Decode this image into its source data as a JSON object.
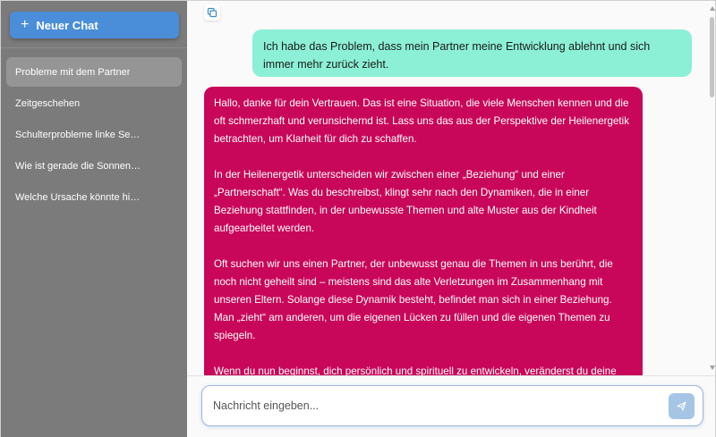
{
  "sidebar": {
    "new_chat_label": "Neuer Chat",
    "items": [
      {
        "label": "Probleme mit dem Partner",
        "active": true
      },
      {
        "label": "Zeitgeschehen"
      },
      {
        "label": "Schulterprobleme linke Se…"
      },
      {
        "label": "Wie ist gerade die Sonnen…"
      },
      {
        "label": "Welche Ursache könnte hi…"
      }
    ]
  },
  "chat": {
    "user_message": "Ich habe das Problem, dass mein Partner meine Entwicklung ablehnt und sich immer mehr zurück zieht.",
    "assistant_paragraphs": [
      "Hallo, danke für dein Vertrauen. Das ist eine Situation, die viele Menschen kennen und die oft schmerzhaft und verunsichernd ist. Lass uns das aus der Perspektive der Heilenergetik betrachten, um Klarheit für dich zu schaffen.",
      "In der Heilenergetik unterscheiden wir zwischen einer „Beziehung“ und einer „Partnerschaft“. Was du beschreibst, klingt sehr nach den Dynamiken, die in einer Beziehung stattfinden, in der unbewusste Themen und alte Muster aus der Kindheit aufgearbeitet werden.",
      "Oft suchen wir uns einen Partner, der unbewusst genau die Themen in uns berührt, die noch nicht geheilt sind – meistens sind das alte Verletzungen im Zusammenhang mit unseren Eltern. Solange diese Dynamik besteht, befindet man sich in einer Beziehung. Man „zieht“ am anderen, um die eigenen Lücken zu füllen und die eigenen Themen zu spiegeln.",
      "Wenn du nun beginnst, dich persönlich und spirituell zu entwickeln, veränderst du deine"
    ]
  },
  "input": {
    "placeholder": "Nachricht eingeben..."
  },
  "colors": {
    "sidebar_bg": "#7b7b7b",
    "new_chat_bg": "#4a8dd9",
    "user_bubble": "#8cf0d6",
    "assistant_bubble": "#c8075a",
    "send_button": "#a6c4e6"
  },
  "icons": {
    "new_chat": "plus-icon",
    "copy": "copy-icon",
    "send": "send-icon"
  }
}
